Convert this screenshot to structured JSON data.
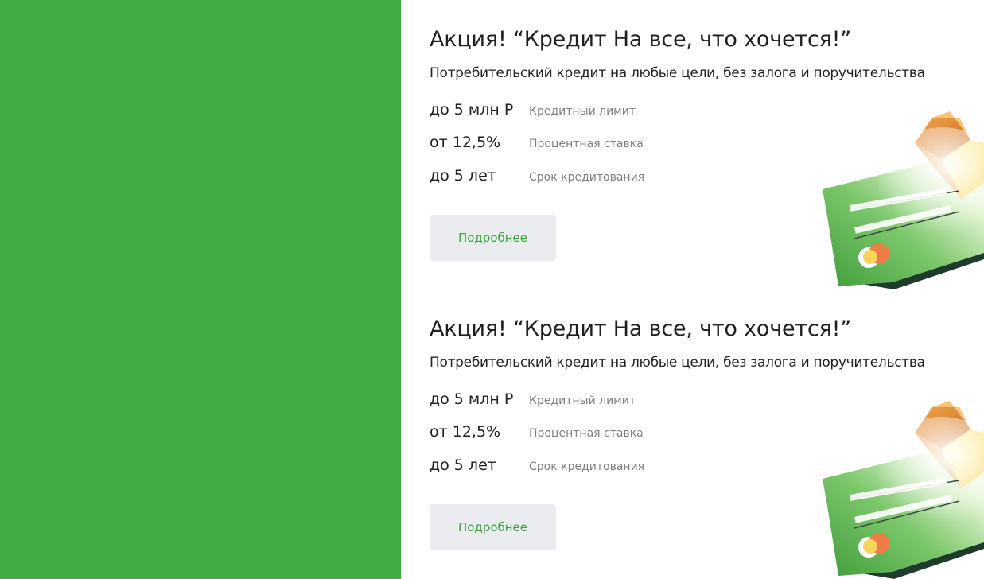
{
  "offers": [
    {
      "title": "Акция! “Кредит На все, что хочется!”",
      "subtitle": "Потребительский кредит на любые цели, без залога и поручительства",
      "stats": [
        {
          "value": "до 5 млн Р",
          "label": "Кредитный лимит"
        },
        {
          "value": "от 12,5%",
          "label": "Процентная ставка"
        },
        {
          "value": "до 5 лет",
          "label": "Срок кредитования"
        }
      ],
      "button_label": "Подробнее",
      "illustration_icon": "credit-card-icon"
    },
    {
      "title": "Акция! “Кредит На все, что хочется!”",
      "subtitle": "Потребительский кредит на любые цели, без залога и поручительства",
      "stats": [
        {
          "value": "до 5 млн Р",
          "label": "Кредитный лимит"
        },
        {
          "value": "от 12,5%",
          "label": "Процентная ставка"
        },
        {
          "value": "до 5 лет",
          "label": "Срок кредитования"
        }
      ],
      "button_label": "Подробнее",
      "illustration_icon": "credit-card-icon"
    }
  ],
  "colors": {
    "side_panel": "#43ab45",
    "button_bg": "#ebecf0",
    "button_text": "#3aa33c",
    "text_primary": "#1f1f22",
    "text_secondary": "#7d7d83"
  }
}
